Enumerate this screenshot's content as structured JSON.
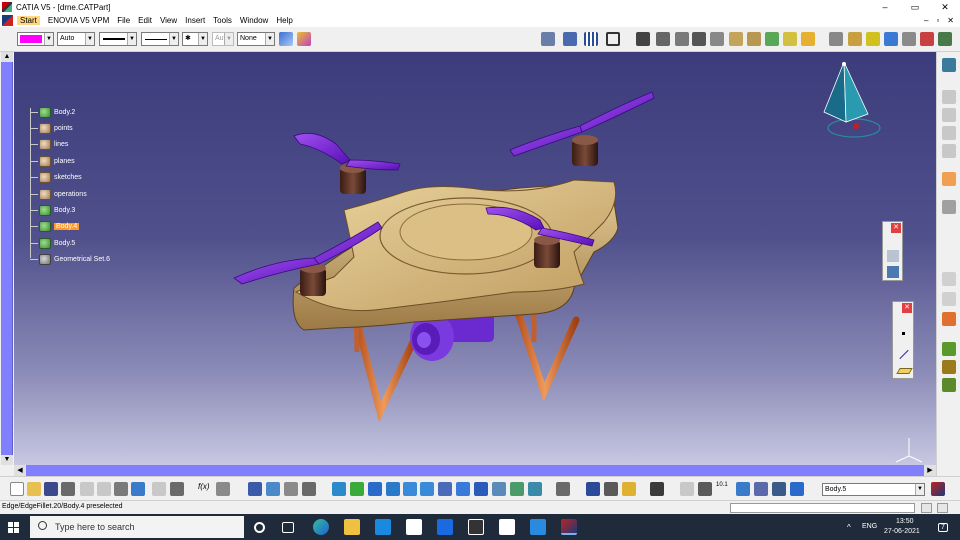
{
  "window": {
    "title": "CATIA V5 - [drne.CATPart]",
    "controls": {
      "minimize": "–",
      "restore": "▭",
      "close": "✕"
    }
  },
  "menu": {
    "items": [
      "Start",
      "ENOVIA V5 VPM",
      "File",
      "Edit",
      "View",
      "Insert",
      "Tools",
      "Window",
      "Help"
    ],
    "doc_controls": [
      "–",
      "▫",
      "✕"
    ]
  },
  "properties_bar": {
    "color_swatch": "#ff00ff",
    "line_type_value": "Auto",
    "point_symbol": "✱",
    "layer_value": "Aut",
    "none_value": "None"
  },
  "spec_tree": {
    "items": [
      {
        "label": "Body.2",
        "icon": "body-icon"
      },
      {
        "label": "points",
        "icon": "geometrical-set-icon"
      },
      {
        "label": "lines",
        "icon": "geometrical-set-icon"
      },
      {
        "label": "planes",
        "icon": "geometrical-set-icon"
      },
      {
        "label": "sketches",
        "icon": "geometrical-set-icon"
      },
      {
        "label": "operations",
        "icon": "geometrical-set-icon"
      },
      {
        "label": "Body.3",
        "icon": "body-icon"
      },
      {
        "label": "Body.4",
        "icon": "body-icon",
        "selected": true
      },
      {
        "label": "Body.5",
        "icon": "body-icon"
      },
      {
        "label": "Geometrical Set.6",
        "icon": "geometrical-set-icon"
      }
    ]
  },
  "bottom_toolbar": {
    "current_body": "Body.5",
    "fx_label": "f(x)",
    "scale_label": "10.1"
  },
  "status": {
    "message": "Edge/EdgeFillet.20/Body.4 preselected"
  },
  "taskbar": {
    "search_placeholder": "Type here to search",
    "language": "ENG",
    "time": "13:50",
    "date": "27-06-2021",
    "notification_count": "7"
  },
  "colors": {
    "background_top": "#3c3c7c",
    "background_bottom": "#c8c8e2",
    "body_tan": "#d4b67e",
    "propeller_purple": "#7a1ee0",
    "leg_orange": "#e07a3a",
    "selection_orange": "#ff9a2a"
  }
}
